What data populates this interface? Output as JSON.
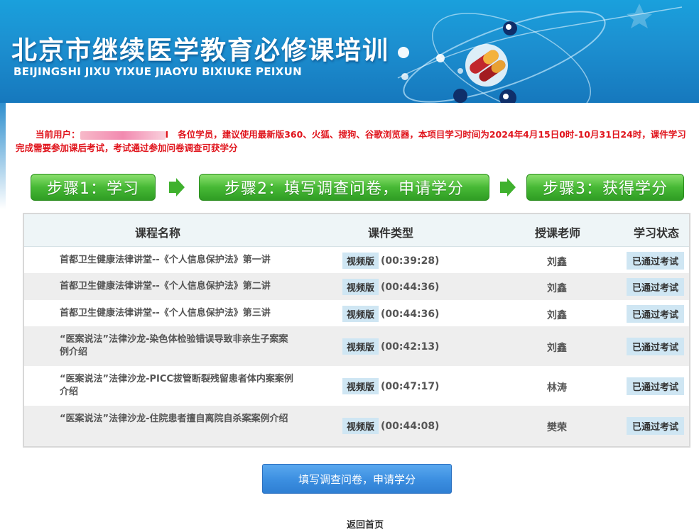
{
  "banner": {
    "title": "北京市继续医学教育必修课培训",
    "subtitle": "BEIJINGSHI JIXU YIXUE JIAOYU BIXIUKE PEIXUN"
  },
  "notice": {
    "prefix": "当前用户：",
    "user_tail": "I",
    "text": "各位学员，建议使用最新版360、火狐、搜狗、谷歌浏览器，本项目学习时间为2024年4月15日0时-10月31日24时，课件学习完成需要参加课后考试，考试通过参加问卷调查可获学分"
  },
  "steps": [
    {
      "label": "步骤1：学习"
    },
    {
      "label": "步骤2：填写调查问卷，申请学分"
    },
    {
      "label": "步骤3：获得学分"
    }
  ],
  "table": {
    "headers": {
      "name": "课程名称",
      "type": "课件类型",
      "teacher": "授课老师",
      "status": "学习状态"
    },
    "rows": [
      {
        "name": "首都卫生健康法律讲堂--《个人信息保护法》第一讲",
        "type_tag": "视频版",
        "duration": "(00:39:28)",
        "teacher": "刘鑫",
        "status": "已通过考试"
      },
      {
        "name": "首都卫生健康法律讲堂--《个人信息保护法》第二讲",
        "type_tag": "视频版",
        "duration": "(00:44:36)",
        "teacher": "刘鑫",
        "status": "已通过考试"
      },
      {
        "name": "首都卫生健康法律讲堂--《个人信息保护法》第三讲",
        "type_tag": "视频版",
        "duration": "(00:44:36)",
        "teacher": "刘鑫",
        "status": "已通过考试"
      },
      {
        "name": "“医案说法”法律沙龙-染色体检验错误导致非亲生子案案例介绍",
        "type_tag": "视频版",
        "duration": "(00:42:13)",
        "teacher": "刘鑫",
        "status": "已通过考试"
      },
      {
        "name": "“医案说法”法律沙龙-PICC拔管断裂残留患者体内案案例介绍",
        "type_tag": "视频版",
        "duration": "(00:47:17)",
        "teacher": "林涛",
        "status": "已通过考试"
      },
      {
        "name": "“医案说法”法律沙龙-住院患者擅自离院自杀案案例介绍",
        "type_tag": "视频版",
        "duration": "(00:44:08)",
        "teacher": "樊荣",
        "status": "已通过考试"
      }
    ]
  },
  "submit_button": "填写调查问卷，申请学分",
  "home_link": "返回首页",
  "colors": {
    "banner": "#1c8fd0",
    "notice": "#e0141c",
    "step_green": "#47b935",
    "button_blue": "#3b8ee0"
  }
}
